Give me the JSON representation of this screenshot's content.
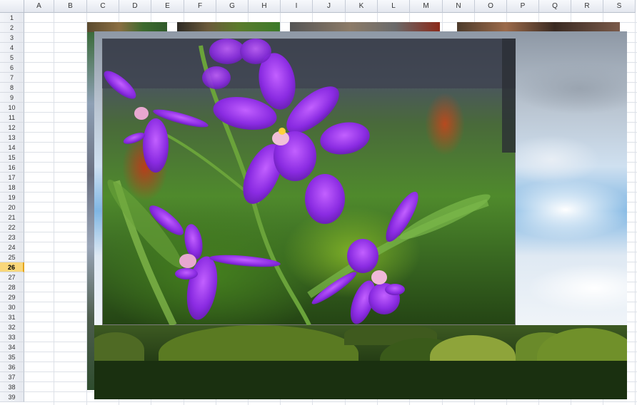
{
  "spreadsheet": {
    "columns": [
      "A",
      "B",
      "C",
      "D",
      "E",
      "F",
      "G",
      "H",
      "I",
      "J",
      "K",
      "L",
      "M",
      "N",
      "O",
      "P",
      "Q",
      "R",
      "S"
    ],
    "rows": [
      "1",
      "2",
      "3",
      "4",
      "5",
      "6",
      "7",
      "8",
      "9",
      "10",
      "11",
      "12",
      "13",
      "14",
      "15",
      "16",
      "17",
      "18",
      "19",
      "20",
      "21",
      "22",
      "23",
      "24",
      "25",
      "26",
      "27",
      "28",
      "29",
      "30",
      "31",
      "32",
      "33",
      "34",
      "35",
      "36",
      "37",
      "38",
      "39"
    ],
    "active_row": "26"
  },
  "pictures": {
    "orchid": {
      "subject": "purple orchids"
    },
    "landscape": {
      "subject": "green hills under cloudy sky"
    }
  },
  "colors": {
    "active_row_header": "#f9d77a",
    "orchid_petal": "#8a2be2",
    "grid": "#dde1e8"
  }
}
